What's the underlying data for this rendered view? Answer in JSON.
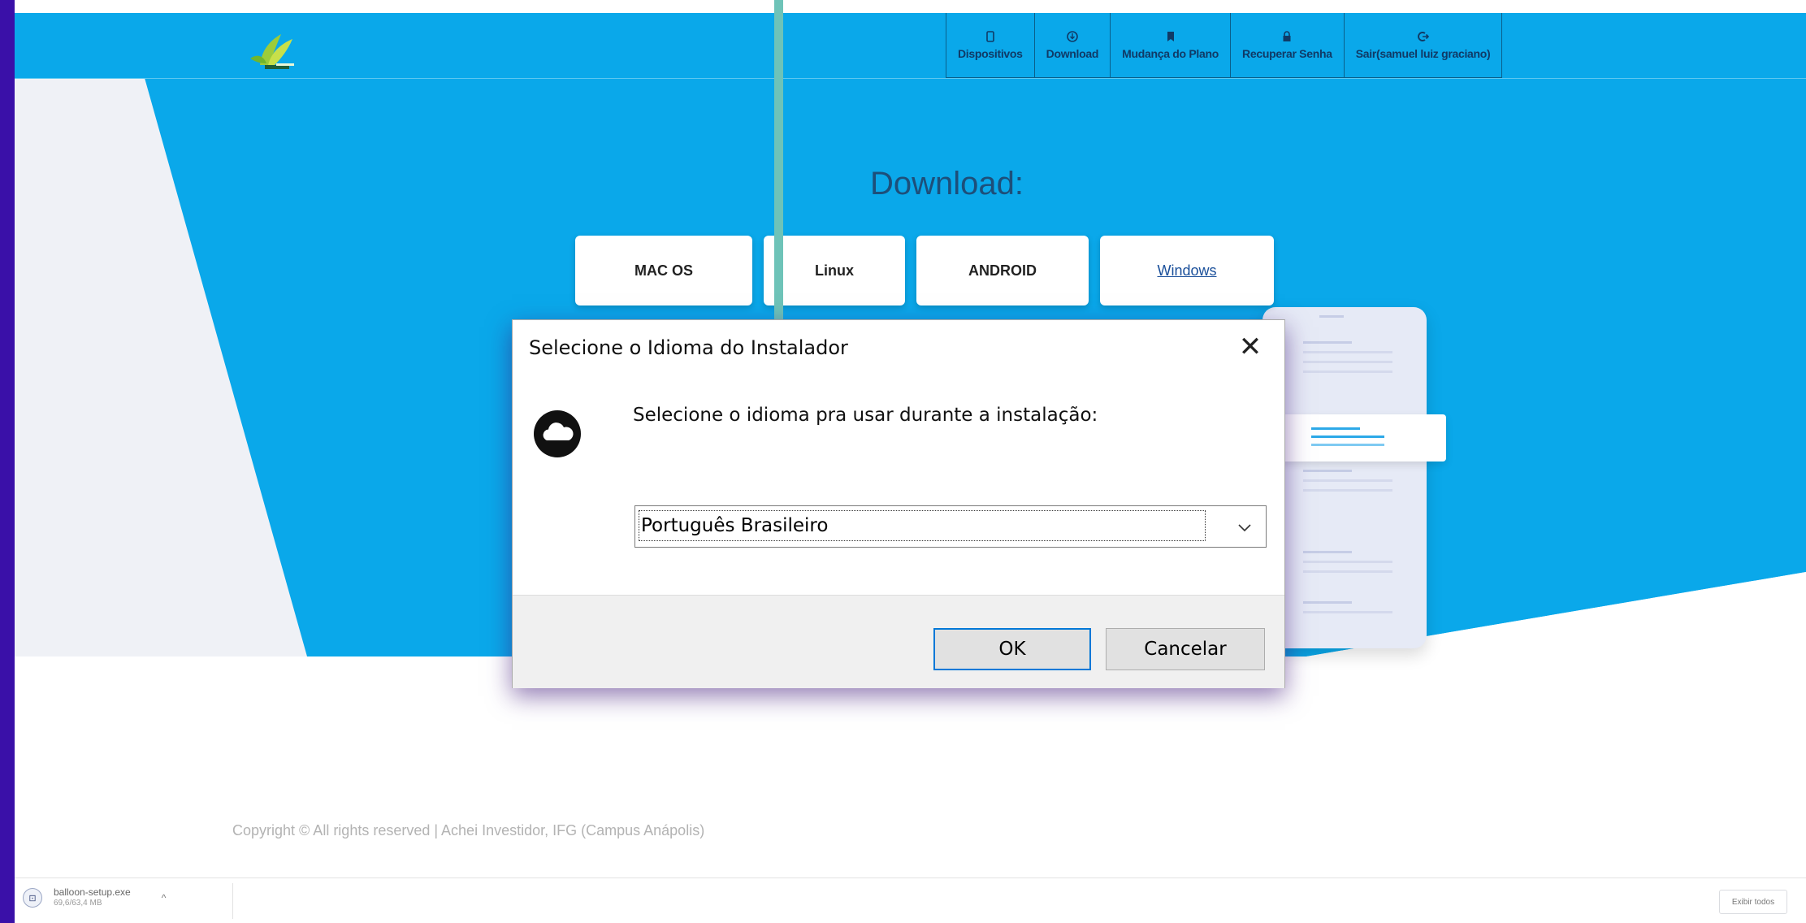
{
  "colors": {
    "frame": "#3a10a8",
    "nav_bar": "#0aa8ea",
    "hero_blue": "#0aa8ea",
    "hero_grey": "#eff1f6",
    "vertical_line": "#6ec3b8",
    "dialog_ok_border": "#0078d7"
  },
  "header": {
    "logo_icon": "leaf-logo-icon",
    "nav": [
      {
        "label": "Dispositivos",
        "icon": "smartphone-icon"
      },
      {
        "label": "Download",
        "icon": "download-icon"
      },
      {
        "label": "Mudança do Plano",
        "icon": "bookmark-icon"
      },
      {
        "label": "Recuperar Senha",
        "icon": "lock-icon"
      },
      {
        "label": "Sair(samuel luiz graciano)",
        "icon": "logout-icon"
      }
    ]
  },
  "hero": {
    "title": "Download:",
    "os_buttons": [
      "MAC OS",
      "Linux",
      "ANDROID",
      "Windows"
    ]
  },
  "dialog": {
    "title": "Selecione o Idioma do Instalador",
    "close_label": "✕",
    "icon": "cloud-icon",
    "prompt": "Selecione o idioma pra usar durante a instalação:",
    "selected_language": "Português Brasileiro",
    "ok_label": "OK",
    "cancel_label": "Cancelar"
  },
  "footer": {
    "copyright": "Copyright © All rights reserved | Achei Investidor, IFG (Campus Anápolis)"
  },
  "downloads_bar": {
    "file_name": "balloon-setup.exe",
    "file_size": "69,6/63,4 MB",
    "file_icon": "installer-file-icon",
    "show_all_label": "Exibir todos"
  }
}
